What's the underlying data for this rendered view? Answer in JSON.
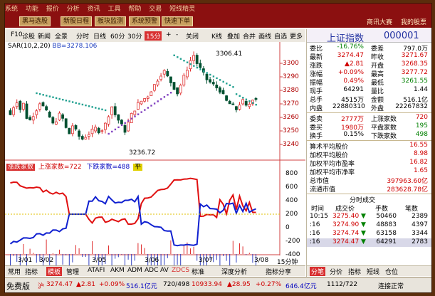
{
  "topbar": {
    "menu": [
      "系统",
      "功能",
      "报价",
      "分析",
      "资讯",
      "工具",
      "帮助",
      "交易",
      "短线精灵"
    ],
    "buttons": [
      "黑马选股",
      "新股日程",
      "板块监测",
      "系统预警",
      "快速下单"
    ],
    "right_links": [
      "商讯大赛",
      "我的股票"
    ]
  },
  "toolbar": {
    "items": [
      "F10",
      "诊股",
      "新闻",
      "全景",
      "分时",
      "日线",
      "60分",
      "30分",
      "15分",
      "+",
      "-",
      "关闭",
      "K线",
      "叠加",
      "合并",
      "画线",
      "自选",
      "更多"
    ],
    "selected": "15分"
  },
  "chart": {
    "sar_label": "SAR(10,2,20)",
    "bb_label": "BB=3278.106",
    "high_label": "3306.41",
    "low_label": "3236.72",
    "y_ticks": [
      "3300",
      "3290",
      "3280",
      "3270",
      "3260",
      "3250",
      "3240"
    ],
    "indicator": {
      "a": "涨跌家数",
      "b": "上涨家数=722",
      "c": "下跌家数=488",
      "d": "平"
    },
    "ind_ticks": [
      "800",
      "600",
      "400",
      "200",
      "0",
      "-200",
      "-400"
    ],
    "x_ticks": [
      "3/01",
      "3/02",
      "3/05",
      "3/06",
      "3/07",
      "3/08"
    ],
    "x_right": "15分钟"
  },
  "bottombar": {
    "items": [
      "常用",
      "指标",
      "模板",
      "管理",
      "ATAFI",
      "AKM",
      "ADM",
      "ADC",
      "AV",
      "ZDCS",
      "标准",
      "深度分析",
      "指标分享"
    ],
    "selected": "模板"
  },
  "panel": {
    "name": "上证指数",
    "code": "000001",
    "quote": [
      {
        "l1": "委比",
        "v1": "-16.76%",
        "l2": "委差",
        "v2": "797.0万"
      },
      {
        "l1": "最新",
        "v1": "3274.47",
        "l2": "昨收",
        "v2": "3271.67"
      },
      {
        "l1": "涨跌",
        "v1": "▲2.81",
        "l2": "开盘",
        "v2": "3268.35"
      },
      {
        "l1": "涨幅",
        "v1": "+0.09%",
        "l2": "最高",
        "v2": "3277.72"
      },
      {
        "l1": "振幅",
        "v1": "0.49%",
        "l2": "最低",
        "v2": "3261.55"
      },
      {
        "l1": "现手",
        "v1": "64291",
        "l2": "量比",
        "v2": "1.44"
      },
      {
        "l1": "总手",
        "v1": "4515万",
        "l2": "金额",
        "v2": "516.1亿"
      },
      {
        "l1": "内盘",
        "v1": "22880310",
        "l2": "外盘",
        "v2": "22267832"
      }
    ],
    "breadth": [
      {
        "l1": "委卖",
        "v1": "2777万",
        "l2": "上涨家数",
        "v2": "720"
      },
      {
        "l1": "委买",
        "v1": "1980万",
        "l2": "平盘家数",
        "v2": "195"
      },
      {
        "l1": "换手",
        "v1": "0.15%",
        "l2": "下跌家数",
        "v2": "498"
      }
    ],
    "stats": [
      {
        "l": "算术平均股价",
        "v": "16.55"
      },
      {
        "l": "加权平均股价",
        "v": "8.98"
      },
      {
        "l": "加权平均市盈率",
        "v": "16.82"
      },
      {
        "l": "加权平均市净率",
        "v": "1.65"
      },
      {
        "l": "总市值",
        "v": "397963.60亿"
      },
      {
        "l": "流通市值",
        "v": "283628.78亿"
      }
    ],
    "trades_title": "分时成交",
    "trades_header": [
      "时间",
      "成交价",
      "手数",
      "笔数"
    ],
    "trades": [
      {
        "t": "10:15",
        "p": "3275.40",
        "d": "▼",
        "v": "50460",
        "n": "2389"
      },
      {
        "t": ":16",
        "p": "3274.90",
        "d": "▼",
        "v": "48883",
        "n": "4397"
      },
      {
        "t": ":16",
        "p": "3274.74",
        "d": "▼",
        "v": "63158",
        "n": "3344"
      },
      {
        "t": ":16",
        "p": "3274.47",
        "d": "▼",
        "v": "64291",
        "n": "2783"
      }
    ],
    "tabs": [
      "分笔",
      "分价",
      "指标",
      "短线",
      "仓位"
    ],
    "tab_selected": "分笔"
  },
  "status": {
    "label": "免费版",
    "prefix": "沪",
    "price": "3274.47",
    "change": "▲2.81",
    "pct": "+0.09%",
    "amount": "516.1亿元",
    "ratio1": "720/498",
    "sz_price": "10933.94",
    "sz_change": "▲28.95",
    "sz_pct": "+0.27%",
    "sz_amount": "646.4亿元",
    "ratio2": "1112/722",
    "conn": "连接正常"
  }
}
